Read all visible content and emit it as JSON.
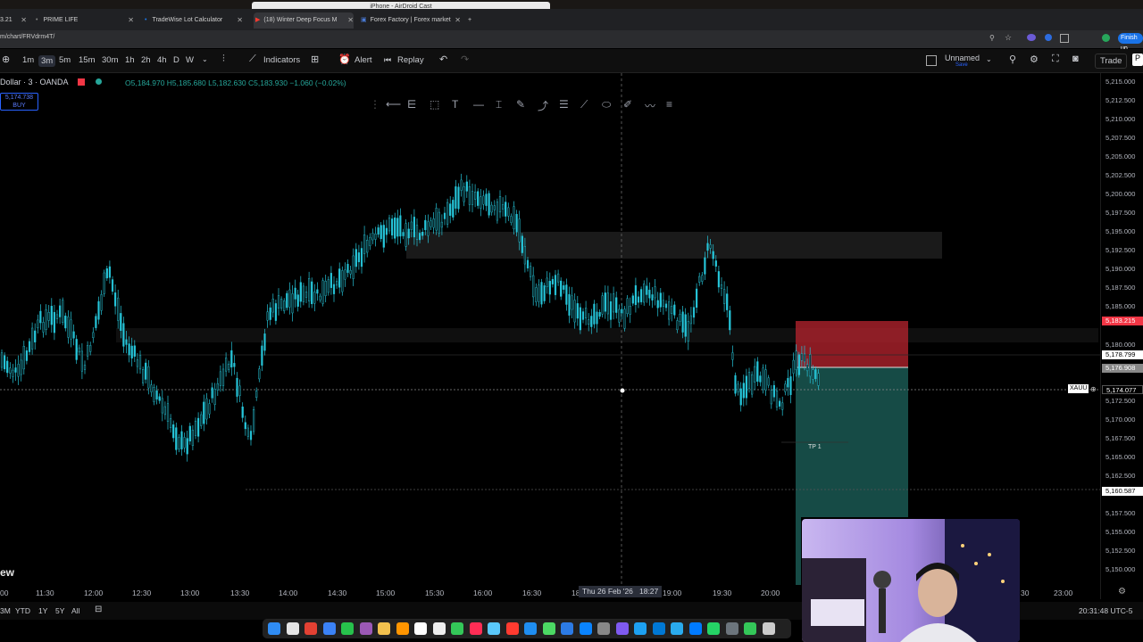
{
  "browser": {
    "airdrop_title": "iPhone - AirDroid Cast",
    "tabs": [
      {
        "label": "3.21"
      },
      {
        "label": "PRIME LIFE"
      },
      {
        "label": "TradeWise Lot Calculator"
      },
      {
        "label": "(18) Winter Deep Focus M"
      },
      {
        "label": "Forex Factory | Forex market"
      }
    ],
    "url": "m/chart/FRVdrm4T/",
    "finish_update": "Finish up"
  },
  "toolbar": {
    "intervals": [
      "1m",
      "3m",
      "5m",
      "15m",
      "30m",
      "1h",
      "2h",
      "4h",
      "D",
      "W"
    ],
    "active_interval": "3m",
    "indicators_label": "Indicators",
    "alert_label": "Alert",
    "replay_label": "Replay",
    "layout_name": "Unnamed",
    "layout_sub": "Save",
    "trade_label": "Trade"
  },
  "legend": {
    "symbol": "Dollar · 3 · OANDA",
    "ohlc": "O5,184.970 H5,185.680 L5,182.630 C5,183.930 −1.060 (−0.02%)",
    "order_price": "5,174.738",
    "order_side": "BUY"
  },
  "price_axis": {
    "labels": [
      "5,215.000",
      "5,212.500",
      "5,210.000",
      "5,207.500",
      "5,205.000",
      "5,202.500",
      "5,200.000",
      "5,197.500",
      "5,195.000",
      "5,192.500",
      "5,190.000",
      "5,187.500",
      "5,185.000",
      "5,180.000",
      "5,172.500",
      "5,170.000",
      "5,167.500",
      "5,165.000",
      "5,162.500",
      "5,157.500",
      "5,155.000",
      "5,152.500",
      "5,150.000"
    ],
    "stop_tag": "5,183.215",
    "entry_tag": "5,178.799",
    "current_tag": "5,176.908",
    "last_tag": "5,174.077",
    "target_tag": "5,160.587",
    "symbol_tag": "XAUU",
    "stop_color": "#f23645",
    "target_color": "#26a69a"
  },
  "time_axis": {
    "labels": [
      "00",
      "11:30",
      "12:00",
      "12:30",
      "13:00",
      "13:30",
      "14:00",
      "14:30",
      "15:00",
      "15:30",
      "16:00",
      "16:30",
      "18",
      "19:00",
      "19:30",
      "20:00",
      "30",
      "23:00"
    ],
    "crosshair": "Thu 26 Feb '26   18:27"
  },
  "position": {
    "tp_label": "TP 1"
  },
  "bottom": {
    "ranges": [
      "3M",
      "YTD",
      "1Y",
      "5Y",
      "All"
    ],
    "clock": "20:31:48 UTC-5",
    "corner_text": "ew"
  },
  "colors": {
    "candle": "#26c6da",
    "background": "#000000"
  }
}
